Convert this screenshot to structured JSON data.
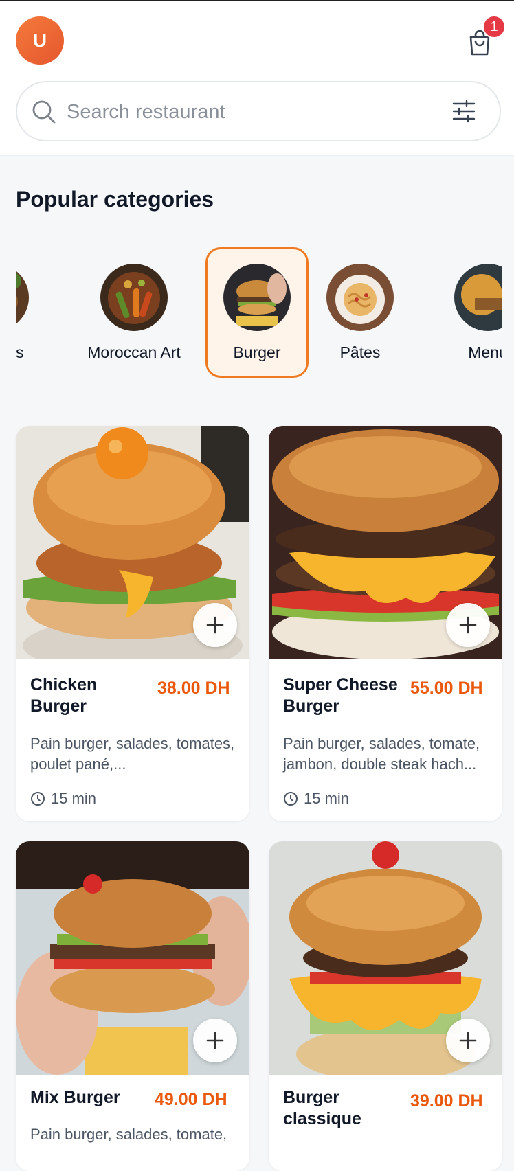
{
  "header": {
    "avatar_initial": "U",
    "cart_count": "1",
    "search_placeholder": "Search restaurant"
  },
  "section_title": "Popular categories",
  "categories": [
    {
      "label": "Salades",
      "active": false
    },
    {
      "label": "Moroccan Art",
      "active": false
    },
    {
      "label": "Burger",
      "active": true
    },
    {
      "label": "Pâtes",
      "active": false
    },
    {
      "label": "Menu",
      "active": false
    }
  ],
  "products": [
    {
      "name": "Chicken Burger",
      "price": "38.00 DH",
      "description": "Pain burger, salades, tomates, poulet pané,...",
      "time": "15 min"
    },
    {
      "name": "Super Cheese Burger",
      "price": "55.00 DH",
      "description": "Pain burger, salades, tomate, jambon, double steak hach...",
      "time": "15 min"
    },
    {
      "name": "Mix Burger",
      "price": "49.00 DH",
      "description": "Pain burger, salades, tomate,",
      "time": ""
    },
    {
      "name": "Burger classique",
      "price": "39.00 DH",
      "description": "",
      "time": ""
    }
  ],
  "colors": {
    "accent": "#ea580c",
    "badge": "#e63946",
    "active_border": "#f07a22"
  }
}
